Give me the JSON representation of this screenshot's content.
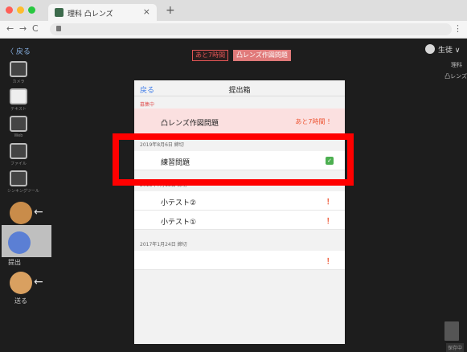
{
  "browser": {
    "tab_title": "理科 凸レンズ",
    "tab_close": "×",
    "new_tab": "+",
    "nav_back": "←",
    "nav_forward": "→",
    "nav_reload": "C",
    "menu": "⋮",
    "light_colors": [
      "#ff5f57",
      "#febc2e",
      "#28c840"
    ]
  },
  "toolbar": {
    "back_label": "〈 戻る",
    "tools": [
      {
        "label": "カメラ"
      },
      {
        "label": "テキスト"
      },
      {
        "label": "Web"
      },
      {
        "label": "ファイル"
      },
      {
        "label": "シンキングツール"
      }
    ],
    "submit_label": "提出",
    "send_label": "送る"
  },
  "header": {
    "remaining": "あと7時間",
    "assignment": "凸レンズ作図問題"
  },
  "user": {
    "name": "生徒 ∨",
    "subject": "理科",
    "topic": "凸レンズ"
  },
  "trash_label": "保存中",
  "panel": {
    "back": "戻る",
    "title": "提出箱",
    "sections": [
      {
        "heading": "募集中",
        "items": [
          {
            "label": "凸レンズ作図問題",
            "status": "あと7時間 ！"
          }
        ]
      },
      {
        "heading": "2019年8月6日 締切",
        "items": [
          {
            "label": "練習問題",
            "status": "✓"
          }
        ]
      },
      {
        "heading": "2018年7月18日 締切",
        "items": [
          {
            "label": "小テスト②",
            "status": "！"
          },
          {
            "label": "小テスト①",
            "status": "！"
          }
        ]
      },
      {
        "heading": "2017年1月24日 締切",
        "items": [
          {
            "label": "",
            "status": "！"
          }
        ]
      }
    ]
  },
  "colors": {
    "highlight": "#ff0000",
    "accent": "#e05555",
    "link": "#3d7be8"
  }
}
